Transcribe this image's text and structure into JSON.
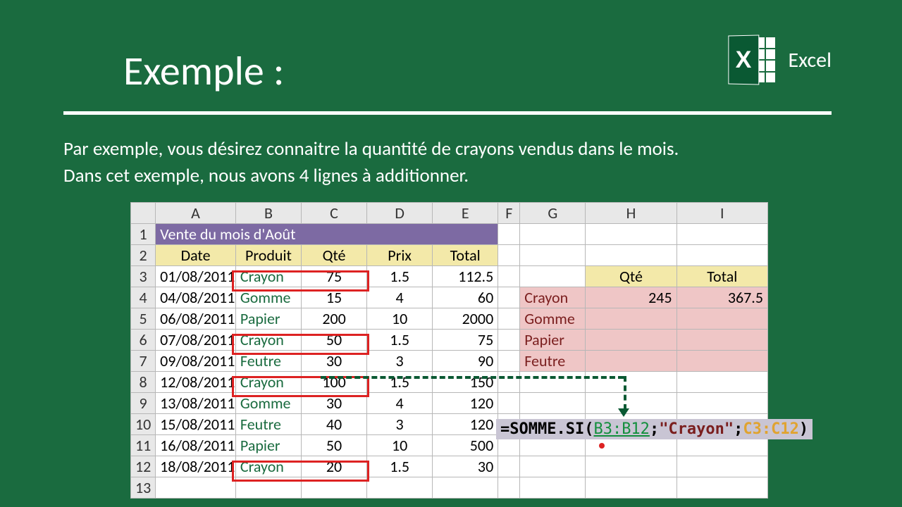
{
  "app": {
    "name": "Excel"
  },
  "slide": {
    "title": "Exemple :",
    "para1": "Par exemple, vous désirez connaitre la quantité de crayons vendus dans le mois.",
    "para2": "Dans cet exemple, nous avons 4 lignes à additionner."
  },
  "cols": [
    "A",
    "B",
    "C",
    "D",
    "E",
    "F",
    "G",
    "H",
    "I"
  ],
  "rowNums": [
    1,
    2,
    3,
    4,
    5,
    6,
    7,
    8,
    9,
    10,
    11,
    12,
    13
  ],
  "tableTitle": "Vente du mois d'Août",
  "headers": {
    "date": "Date",
    "produit": "Produit",
    "qte": "Qté",
    "prix": "Prix",
    "total": "Total"
  },
  "data": [
    {
      "date": "01/08/2011",
      "produit": "Crayon",
      "qte": "75",
      "prix": "1.5",
      "total": "112.5",
      "hl": true
    },
    {
      "date": "04/08/2011",
      "produit": "Gomme",
      "qte": "15",
      "prix": "4",
      "total": "60"
    },
    {
      "date": "06/08/2011",
      "produit": "Papier",
      "qte": "200",
      "prix": "10",
      "total": "2000"
    },
    {
      "date": "07/08/2011",
      "produit": "Crayon",
      "qte": "50",
      "prix": "1.5",
      "total": "75",
      "hl": true
    },
    {
      "date": "09/08/2011",
      "produit": "Feutre",
      "qte": "30",
      "prix": "3",
      "total": "90"
    },
    {
      "date": "12/08/2011",
      "produit": "Crayon",
      "qte": "100",
      "prix": "1.5",
      "total": "150",
      "hl": true
    },
    {
      "date": "13/08/2011",
      "produit": "Gomme",
      "qte": "30",
      "prix": "4",
      "total": "120"
    },
    {
      "date": "15/08/2011",
      "produit": "Feutre",
      "qte": "40",
      "prix": "3",
      "total": "120"
    },
    {
      "date": "16/08/2011",
      "produit": "Papier",
      "qte": "50",
      "prix": "10",
      "total": "500"
    },
    {
      "date": "18/08/2011",
      "produit": "Crayon",
      "qte": "20",
      "prix": "1.5",
      "total": "30",
      "hl": true
    }
  ],
  "summaryHeaders": {
    "qte": "Qté",
    "total": "Total"
  },
  "summary": [
    {
      "name": "Crayon",
      "qte": "245",
      "total": "367.5"
    },
    {
      "name": "Gomme",
      "qte": "",
      "total": ""
    },
    {
      "name": "Papier",
      "qte": "",
      "total": ""
    },
    {
      "name": "Feutre",
      "qte": "",
      "total": ""
    }
  ],
  "formula": {
    "prefix": "=SOMME.SI(",
    "range1": "B3:B12",
    "sep": ";",
    "crit": "\"Crayon\"",
    "range2": "C3:C12",
    "suffix": ")"
  }
}
